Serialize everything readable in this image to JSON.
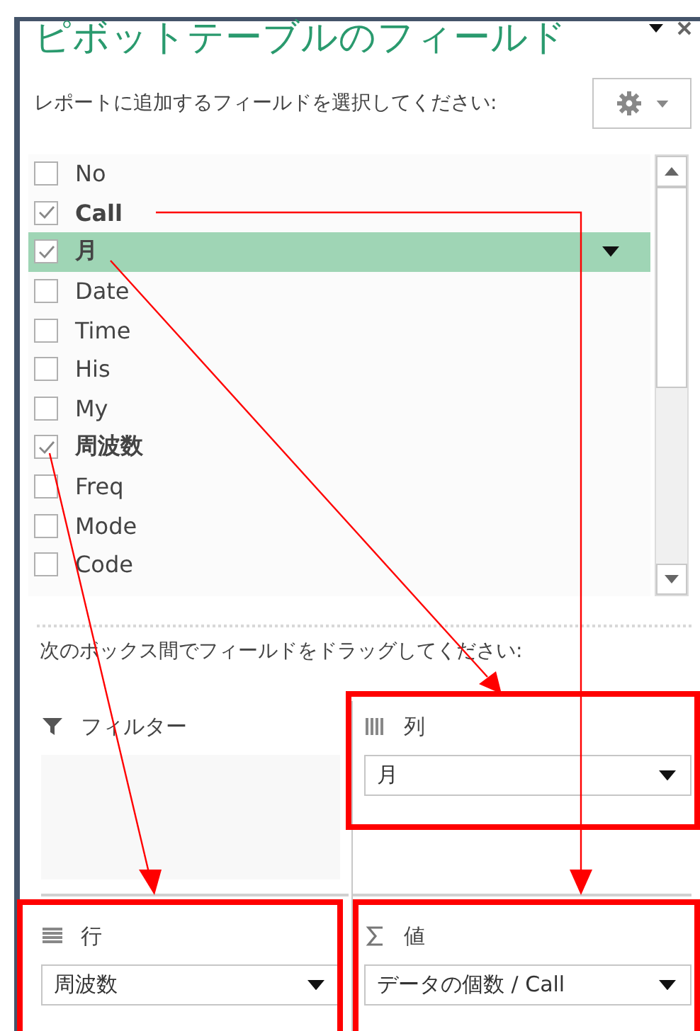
{
  "title": "ピボットテーブルのフィールド",
  "subtitle": "レポートに追加するフィールドを選択してください:",
  "fields": [
    {
      "label": "No",
      "checked": false,
      "selected": false
    },
    {
      "label": "Call",
      "checked": true,
      "selected": false
    },
    {
      "label": "月",
      "checked": true,
      "selected": true
    },
    {
      "label": "Date",
      "checked": false,
      "selected": false
    },
    {
      "label": "Time",
      "checked": false,
      "selected": false
    },
    {
      "label": "His",
      "checked": false,
      "selected": false
    },
    {
      "label": "My",
      "checked": false,
      "selected": false
    },
    {
      "label": "周波数",
      "checked": true,
      "selected": false
    },
    {
      "label": "Freq",
      "checked": false,
      "selected": false
    },
    {
      "label": "Mode",
      "checked": false,
      "selected": false
    },
    {
      "label": "Code",
      "checked": false,
      "selected": false
    }
  ],
  "drag_hint": "次のボックス間でフィールドをドラッグしてください:",
  "areas": [
    {
      "kind": "filter",
      "label": "フィルター"
    },
    {
      "kind": "columns",
      "label": "列",
      "items": [
        "月"
      ]
    },
    {
      "kind": "rows",
      "label": "行",
      "items": [
        "周波数"
      ]
    },
    {
      "kind": "values",
      "label": "値",
      "items": [
        "データの個数 / Call"
      ]
    }
  ]
}
